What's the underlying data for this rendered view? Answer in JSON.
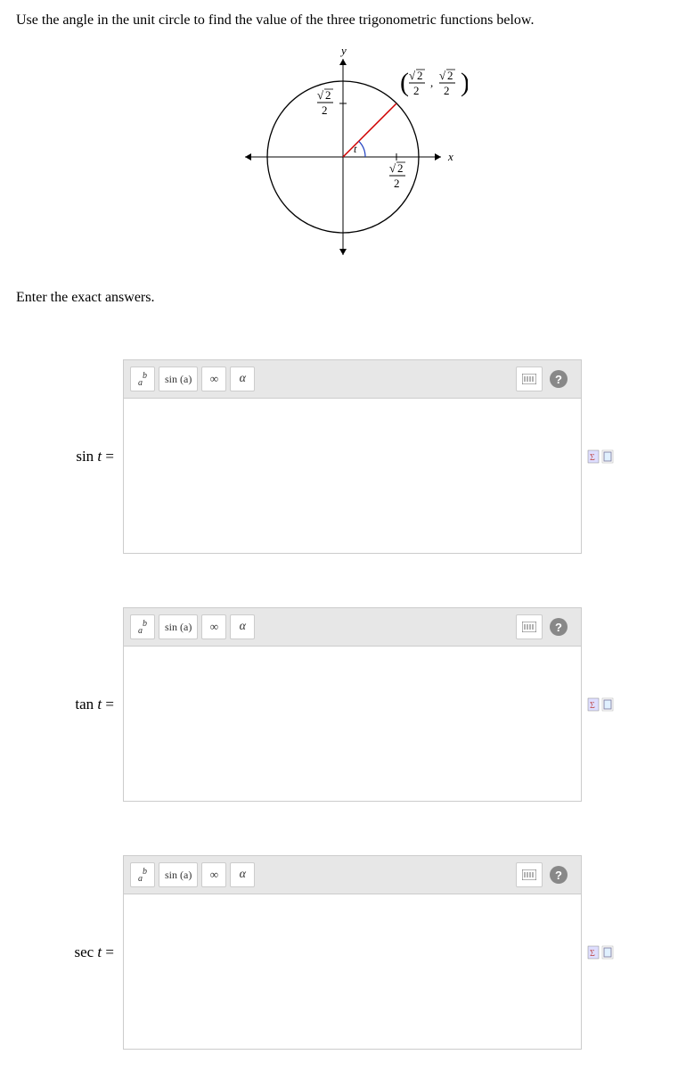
{
  "instruction": "Use the angle in the unit circle to find the value of the three trigonometric functions below.",
  "subinstruction": "Enter the exact answers.",
  "diagram": {
    "y_axis_label": "y",
    "x_axis_label": "x",
    "angle_label": "t",
    "point_label_prefix": "(",
    "point_label_sep": ",",
    "point_label_suffix": ")",
    "y_tick_num": "√2",
    "y_tick_den": "2",
    "x_tick_num": "√2",
    "x_tick_den": "2",
    "pt_x_num": "√2",
    "pt_x_den": "2",
    "pt_y_num": "√2",
    "pt_y_den": "2"
  },
  "toolbar": {
    "exponent_label": "a",
    "exponent_sup": "b",
    "trig_label": "sin (a)",
    "infinity_label": "∞",
    "alpha_label": "α",
    "help_label": "?"
  },
  "answers": [
    {
      "label_func": "sin",
      "label_var": "t"
    },
    {
      "label_func": "tan",
      "label_var": "t"
    },
    {
      "label_func": "sec",
      "label_var": "t"
    }
  ],
  "chart_data": {
    "type": "diagram",
    "description": "Unit circle with angle t in the first quadrant corresponding to 45 degrees; point on circle is (sqrt(2)/2, sqrt(2)/2); x-axis tick at sqrt(2)/2, y-axis tick at sqrt(2)/2.",
    "point": {
      "x": "sqrt(2)/2",
      "y": "sqrt(2)/2"
    },
    "angle_deg": 45
  }
}
